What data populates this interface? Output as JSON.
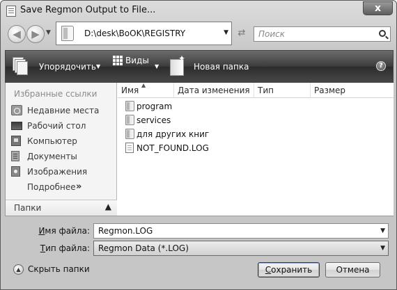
{
  "window": {
    "title": "Save Regmon Output to File...",
    "close_label": "x"
  },
  "nav": {
    "back_glyph": "◀",
    "forward_glyph": "▶",
    "history_glyph": "▼"
  },
  "address": {
    "path": "D:\\desk\\BoOK\\REGISTRY",
    "dropdown_glyph": "▼"
  },
  "refresh_glyph": "⇄",
  "search": {
    "placeholder": "Поиск"
  },
  "toolbar": {
    "organize_label": "Упорядочить",
    "views_label": "Виды",
    "new_folder_label": "Новая папка",
    "dropdown_glyph": "▼",
    "help_glyph": "?"
  },
  "sidebar": {
    "header": "Избранные ссылки",
    "items": [
      {
        "label": "Недавние места",
        "icon": "recent-places-icon"
      },
      {
        "label": "Рабочий стол",
        "icon": "desktop-icon"
      },
      {
        "label": "Компьютер",
        "icon": "computer-icon"
      },
      {
        "label": "Документы",
        "icon": "documents-icon"
      },
      {
        "label": "Изображения",
        "icon": "pictures-icon"
      }
    ],
    "more_label": "Подробнее",
    "more_glyph": "»",
    "folders_label": "Папки",
    "folders_glyph": "▲"
  },
  "file_list": {
    "columns": [
      "Имя",
      "Дата изменения",
      "Тип",
      "Размер"
    ],
    "sort_glyph": "▲",
    "items": [
      {
        "name": "program",
        "kind": "folder"
      },
      {
        "name": "services",
        "kind": "folder"
      },
      {
        "name": "для других книг",
        "kind": "folder"
      },
      {
        "name": "NOT_FOUND.LOG",
        "kind": "file"
      }
    ]
  },
  "form": {
    "filename_label_key": "И",
    "filename_label_rest": "мя файла:",
    "filename_value": "Regmon.LOG",
    "filetype_label_key": "Т",
    "filetype_label_rest": "ип файла:",
    "filetype_value": "Regmon Data (*.LOG)",
    "dropdown_glyph": "▼"
  },
  "footer": {
    "hide_folders_label": "Скрыть папки",
    "hide_folders_glyph": "▲",
    "save_key": "С",
    "save_rest": "охранить",
    "cancel_label": "Отмена"
  }
}
